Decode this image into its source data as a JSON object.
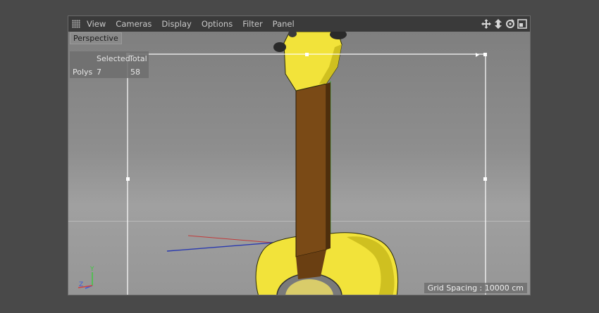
{
  "menubar": {
    "items": [
      "View",
      "Cameras",
      "Display",
      "Options",
      "Filter",
      "Panel"
    ],
    "nav_icons": [
      "move-view-icon",
      "dolly-view-icon",
      "rotate-view-icon",
      "maximize-view-icon"
    ]
  },
  "viewport": {
    "camera_label": "Perspective",
    "hud": {
      "col_selected": "Selected",
      "col_total": "Total",
      "row_label": "Polys",
      "selected": "7",
      "total": "58"
    },
    "grid_spacing": "Grid Spacing : 10000 cm",
    "axis_labels": {
      "y": "Y",
      "z": "Z"
    }
  },
  "colors": {
    "body_yellow": "#f2e33a",
    "neck_brown": "#7a4a16",
    "viewport_bg": "#8e8e8e",
    "selection_frame": "#ffffff"
  }
}
